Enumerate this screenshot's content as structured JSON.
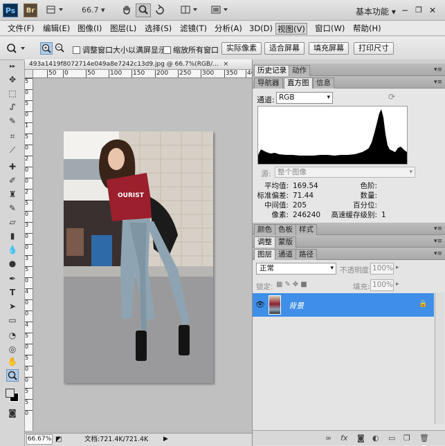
{
  "appbar": {
    "logo_ps": "Ps",
    "logo_br": "Br",
    "zoom": "66.7",
    "workspace": "基本功能",
    "icons": [
      "hand-icon",
      "zoom-icon",
      "rotate-view-icon",
      "arrange-documents-icon",
      "screen-mode-icon",
      "minimize-icon",
      "restore-icon",
      "close-icon"
    ]
  },
  "menubar": {
    "items": [
      "文件(F)",
      "编辑(E)",
      "图像(I)",
      "图层(L)",
      "选择(S)",
      "滤镜(T)",
      "分析(A)",
      "3D(D)",
      "视图(V)",
      "窗口(W)",
      "帮助(H)"
    ],
    "active_index": 8
  },
  "options": {
    "check_resize": "调整窗口大小以满屏显示",
    "check_zoom_all": "缩放所有窗口",
    "buttons": [
      "实际像素",
      "适合屏幕",
      "填充屏幕",
      "打印尺寸"
    ]
  },
  "document": {
    "tab_title": "493a1419f8072714e049a8e7242c13d9.jpg @ 66.7%(RGB/...",
    "ruler_h": [
      "50",
      "0",
      "50",
      "100",
      "150",
      "200",
      "250",
      "300",
      "350",
      "400"
    ],
    "ruler_v": [
      "5",
      "0",
      "5",
      "0",
      "1",
      "5",
      "0",
      "2",
      "0",
      "0",
      "2",
      "5",
      "0",
      "3",
      "0",
      "0",
      "3",
      "5",
      "0",
      "4",
      "0",
      "0",
      "4",
      "5",
      "0",
      "5",
      "0",
      "0",
      "5",
      "5",
      "0"
    ],
    "status_zoom": "66.67%",
    "status_doc": "文档:721.4K/721.4K"
  },
  "panels": {
    "top_tabs": [
      "历史记录",
      "动作"
    ],
    "histo_tabs": [
      "导航器",
      "直方图",
      "信息"
    ],
    "histo_active": 1,
    "channel_label": "通道:",
    "channel_value": "RGB",
    "source_label": "源:",
    "source_value": "整个图像",
    "stats_left": [
      {
        "k": "平均值:",
        "v": "169.54"
      },
      {
        "k": "标准偏差:",
        "v": "71.44"
      },
      {
        "k": "中间值:",
        "v": "205"
      },
      {
        "k": "像素:",
        "v": "246240"
      }
    ],
    "stats_right": [
      {
        "k": "色阶:",
        "v": ""
      },
      {
        "k": "数量:",
        "v": ""
      },
      {
        "k": "百分位:",
        "v": ""
      },
      {
        "k": "高速缓存级别:",
        "v": "1"
      }
    ],
    "color_tabs": [
      "颜色",
      "色板",
      "样式"
    ],
    "adjust_tabs": [
      "调整",
      "蒙版"
    ],
    "layer_tabs": [
      "图层",
      "通道",
      "路径"
    ],
    "blend_mode": "正常",
    "opacity_label": "不透明度:",
    "opacity_value": "100%",
    "lock_label": "锁定:",
    "fill_label": "填充:",
    "fill_value": "100%",
    "layer_name": "背景"
  }
}
